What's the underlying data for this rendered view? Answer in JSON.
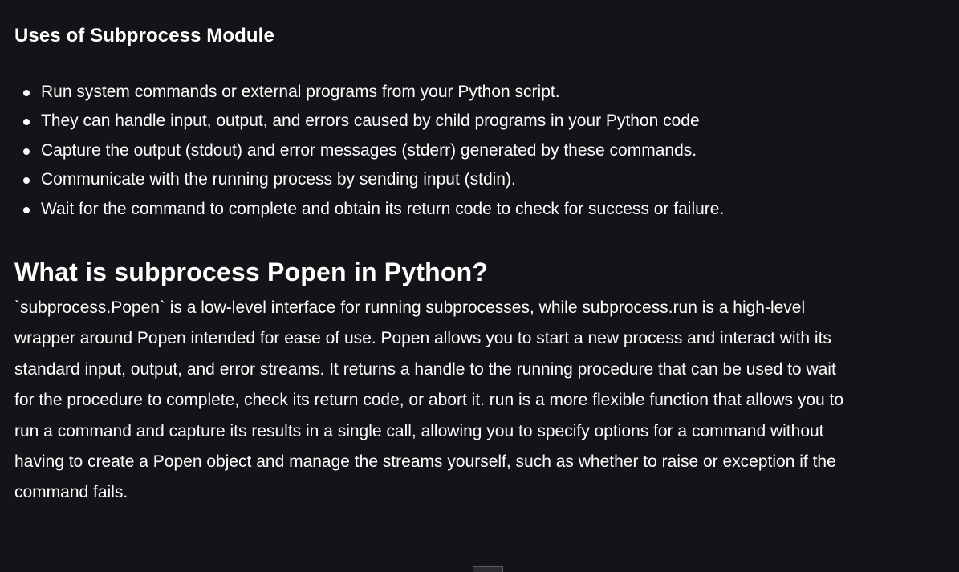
{
  "section1": {
    "heading": "Uses of Subprocess Module",
    "bullets": [
      "Run system commands or external programs from your Python script.",
      "They can handle input, output, and errors caused by child programs in your Python code",
      "Capture the output (stdout) and error messages (stderr) generated by these commands.",
      "Communicate with the running process by sending input (stdin).",
      "Wait for the command to complete and obtain its return code to check for success or failure."
    ]
  },
  "section2": {
    "heading": "What is subprocess Popen in Python?",
    "paragraph": "`subprocess.Popen` is a low-level interface for running subprocesses, while subprocess.run is a high-level wrapper around Popen intended for ease of use. Popen allows you to start a new process and interact with its standard input, output, and error streams. It returns a handle to the running procedure that can be used to wait for the procedure to complete, check its return code, or abort it. run is a more flexible function that allows you to run a command and capture its results in a single call, allowing you to specify options for a command without having to create a Popen object and manage the streams yourself, such as whether to raise or exception if the command fails."
  }
}
